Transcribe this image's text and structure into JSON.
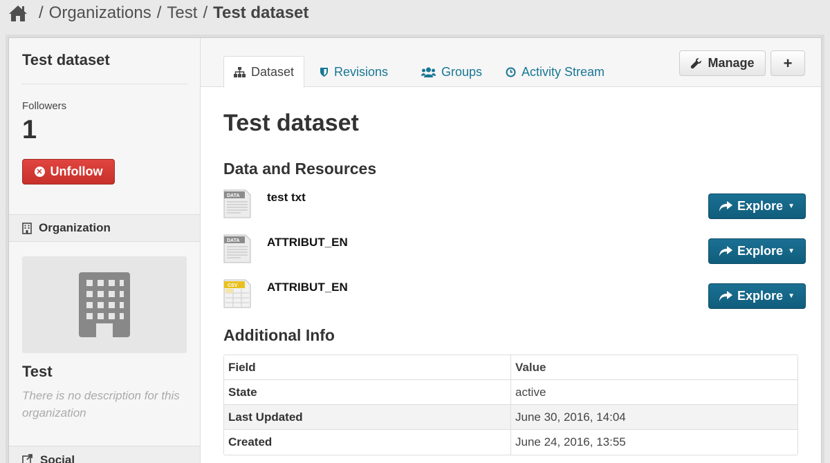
{
  "breadcrumb": {
    "items": [
      "Organizations",
      "Test"
    ],
    "current": "Test dataset",
    "separator": "/"
  },
  "sidebar": {
    "title": "Test dataset",
    "followers_label": "Followers",
    "followers_count": "1",
    "unfollow_label": "Unfollow",
    "organization_header": "Organization",
    "org_name": "Test",
    "org_description": "There is no description for this organization",
    "social_header": "Social"
  },
  "tabs": [
    {
      "label": "Dataset",
      "icon": "sitemap-icon",
      "active": true
    },
    {
      "label": "Revisions",
      "icon": "shield-icon",
      "active": false
    },
    {
      "label": "Groups",
      "icon": "group-icon",
      "active": false
    },
    {
      "label": "Activity Stream",
      "icon": "clock-icon",
      "active": false
    }
  ],
  "actions": {
    "manage_label": "Manage",
    "add_label": "+"
  },
  "main": {
    "title": "Test dataset",
    "resources_heading": "Data and Resources",
    "resources": [
      {
        "name": "test txt",
        "format": "DATA",
        "explore_label": "Explore"
      },
      {
        "name": "ATTRIBUT_EN",
        "format": "DATA",
        "explore_label": "Explore"
      },
      {
        "name": "ATTRIBUT_EN",
        "format": "CSV",
        "explore_label": "Explore"
      }
    ],
    "additional_info_heading": "Additional Info",
    "table": {
      "headers": [
        "Field",
        "Value"
      ],
      "rows": [
        {
          "field": "State",
          "value": "active"
        },
        {
          "field": "Last Updated",
          "value": "June 30, 2016, 14:04"
        },
        {
          "field": "Created",
          "value": "June 24, 2016, 13:55"
        }
      ]
    }
  },
  "colors": {
    "link": "#187794",
    "explore": "#105d7c",
    "unfollow": "#c8302b"
  }
}
